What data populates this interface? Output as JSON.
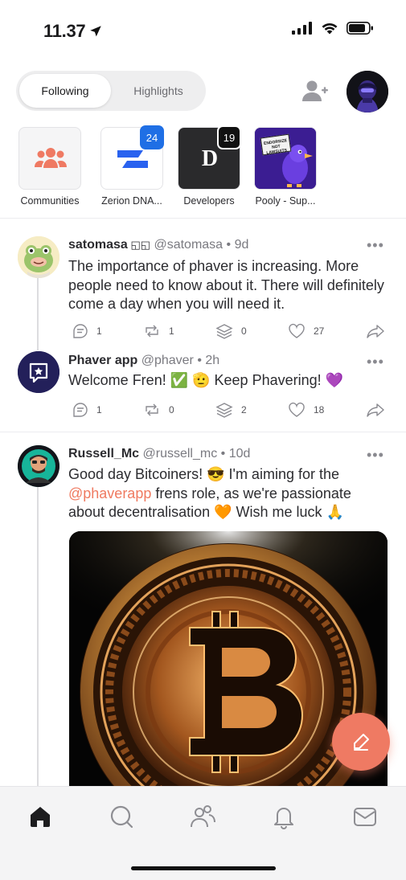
{
  "status_bar": {
    "time": "11.37"
  },
  "tabs": {
    "active": "Following",
    "inactive": "Highlights"
  },
  "communities": [
    {
      "label": "Communities",
      "badge": ""
    },
    {
      "label": "Zerion DNA...",
      "badge": "24"
    },
    {
      "label": "Developers",
      "badge": "19"
    },
    {
      "label": "Pooly - Sup...",
      "badge": ""
    }
  ],
  "pooly_sign": "ENDORSIZE NOT LAWSUITS",
  "developers_letter": "D",
  "posts": [
    {
      "name": "satomasa",
      "name_suffix": " ◱◱",
      "handle": "@satomasa",
      "time": "• 9d",
      "text": "The importance of phaver is increasing. More people need to know about it. There will definitely come a day when you will need it.",
      "counts": {
        "comments": "1",
        "reposts": "1",
        "stacks": "0",
        "likes": "27"
      }
    },
    {
      "name": "Phaver app",
      "handle": "@phaver",
      "time": "• 2h",
      "text": "Welcome Fren! ✅ 🫡 Keep Phavering! 💜",
      "counts": {
        "comments": "1",
        "reposts": "0",
        "stacks": "2",
        "likes": "18"
      }
    },
    {
      "name": "Russell_Mc",
      "handle": "@russell_mc",
      "time": "• 10d",
      "text_pre": "Good day Bitcoiners! 😎  I'm aiming for the ",
      "mention": "@phaverapp",
      "text_post": " frens role, as we're passionate about decentralisation 🧡  Wish me luck 🙏"
    }
  ],
  "more_label": "•••",
  "nav": [
    "home-icon",
    "search-icon",
    "people-icon",
    "bell-icon",
    "mail-icon"
  ],
  "colors": {
    "accent": "#ef7a63",
    "zerion_blue": "#2962ef",
    "badge_blue": "#1f6fe5",
    "badge_dark": "#111111"
  }
}
